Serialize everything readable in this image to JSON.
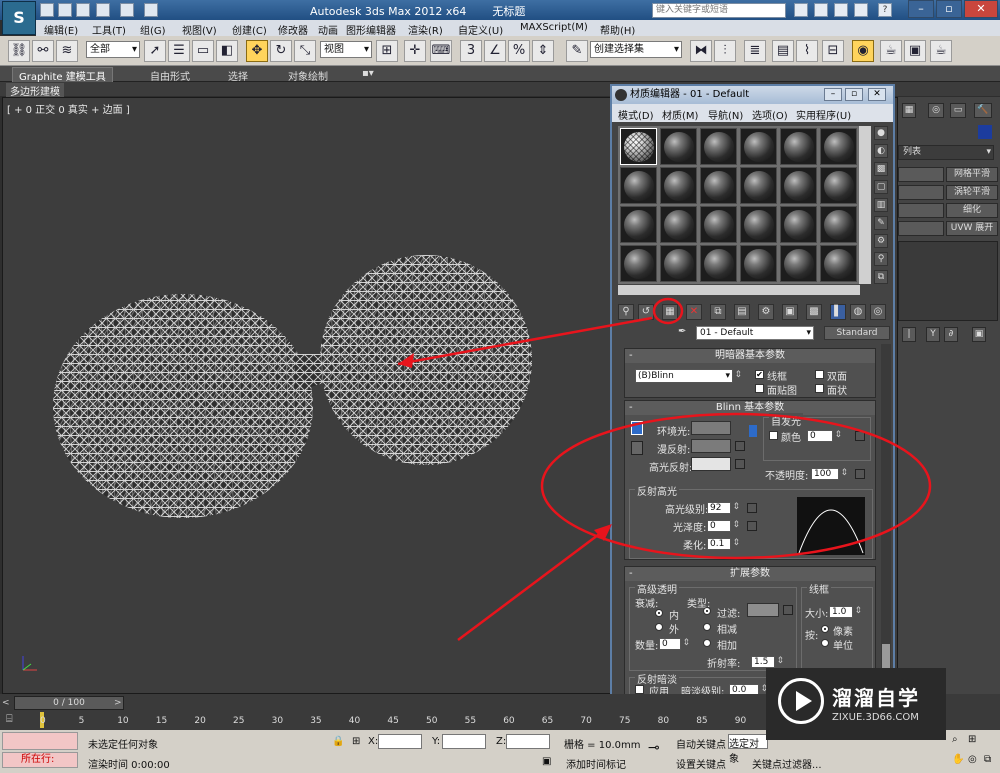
{
  "titlebar": {
    "app_title": "Autodesk 3ds Max  2012 x64",
    "doc_title": "无标题",
    "search_placeholder": "键入关键字或短语",
    "logo": "S",
    "help_icon": "?"
  },
  "menubar": {
    "items": [
      "编辑(E)",
      "工具(T)",
      "组(G)",
      "视图(V)",
      "创建(C)",
      "修改器",
      "动画",
      "图形编辑器",
      "渲染(R)",
      "自定义(U)",
      "MAXScript(M)",
      "帮助(H)"
    ]
  },
  "toolbar": {
    "selection_filter": "全部",
    "ref_coord": "视图",
    "named_selection": "创建选择集"
  },
  "ribbon": {
    "tabs": [
      "Graphite 建模工具",
      "自由形式",
      "选择",
      "对象绘制"
    ],
    "sub_tab": "多边形建模"
  },
  "viewport": {
    "label": "[ + 0 正交 0 真实 + 边面 ]"
  },
  "command_panel": {
    "dropdown_label": "列表",
    "buttons": [
      "网格平滑",
      "涡轮平滑",
      "细化",
      "UVW 展开"
    ]
  },
  "material_editor": {
    "title": "材质编辑器 - 01 - Default",
    "menu": [
      "模式(D)",
      "材质(M)",
      "导航(N)",
      "选项(O)",
      "实用程序(U)"
    ],
    "material_name": "01 - Default",
    "material_type": "Standard",
    "shader_rollout": {
      "title": "明暗器基本参数",
      "shader": "(B)Blinn",
      "options": [
        {
          "label": "线框",
          "checked": true
        },
        {
          "label": "双面",
          "checked": false
        },
        {
          "label": "面贴图",
          "checked": false
        },
        {
          "label": "面状",
          "checked": false
        }
      ]
    },
    "blinn_rollout": {
      "title": "Blinn 基本参数",
      "self_illum_title": "自发光",
      "color_label": "颜色",
      "color_value": "0",
      "ambient_label": "环境光:",
      "diffuse_label": "漫反射:",
      "specular_label": "高光反射:",
      "opacity_label": "不透明度:",
      "opacity_value": "100",
      "highlights_title": "反射高光",
      "spec_level_label": "高光级别:",
      "spec_level_value": "92",
      "gloss_label": "光泽度:",
      "gloss_value": "0",
      "soften_label": "柔化:",
      "soften_value": "0.1"
    },
    "extended_rollout": {
      "title": "扩展参数",
      "advanced_transparency": "高级透明",
      "falloff_label": "衰减:",
      "in_label": "内",
      "out_label": "外",
      "type_label": "类型:",
      "filter_label": "过滤:",
      "subtractive_label": "相减",
      "additive_label": "相加",
      "amount_label": "数量:",
      "amount_value": "0",
      "ior_label": "折射率:",
      "ior_value": "1.5",
      "wire_title": "线框",
      "size_label": "大小:",
      "size_value": "1.0",
      "in_units_label": "按:",
      "pixels_label": "像素",
      "units_label": "单位",
      "reflection_dim": "反射暗淡",
      "apply_label": "应用",
      "dim_level_label": "暗淡级别:",
      "dim_level_value": "0.0"
    }
  },
  "timeline": {
    "frame_counter": "0 / 100",
    "ticks": [
      "0",
      "5",
      "10",
      "15",
      "20",
      "25",
      "30",
      "35",
      "40",
      "45",
      "50",
      "55",
      "60",
      "65",
      "70",
      "75",
      "80",
      "85",
      "90"
    ]
  },
  "status": {
    "running": "所在行:",
    "selection_status": "未选定任何对象",
    "render_time": "渲染时间  0:00:00",
    "x_label": "X:",
    "y_label": "Y:",
    "z_label": "Z:",
    "grid": "栅格 = 10.0mm",
    "add_time_tag": "添加时间标记",
    "auto_key": "自动关键点",
    "selected_object": "选定对象",
    "set_key": "设置关键点",
    "key_filters": "关键点过滤器..."
  },
  "watermark": {
    "name": "溜溜自学",
    "url": "ZIXUE.3D66.COM"
  },
  "annotation": {
    "color": "#e8141c"
  }
}
